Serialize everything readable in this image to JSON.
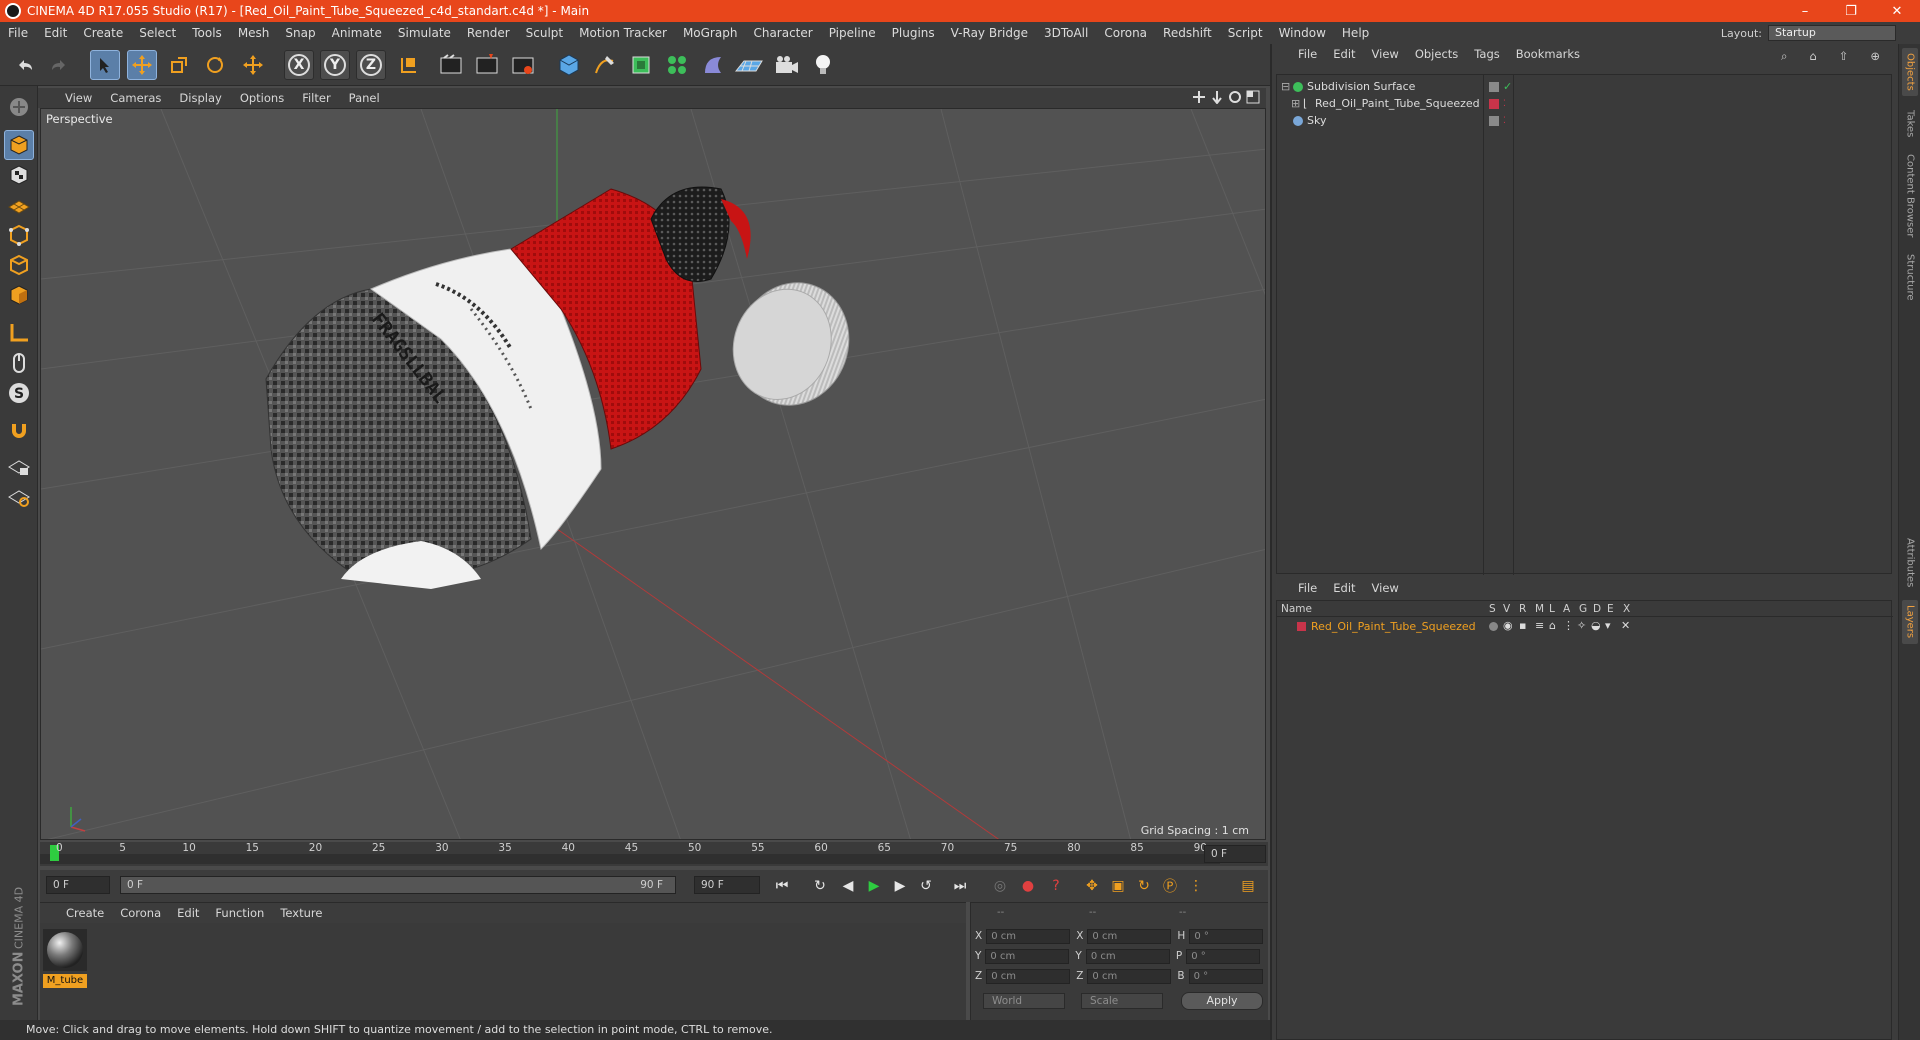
{
  "window": {
    "title": "CINEMA 4D R17.055 Studio (R17) - [Red_Oil_Paint_Tube_Squeezed_c4d_standart.c4d *] - Main",
    "controls": [
      "–",
      "❐",
      "✕"
    ]
  },
  "menubar": {
    "items": [
      "File",
      "Edit",
      "Create",
      "Select",
      "Tools",
      "Mesh",
      "Snap",
      "Animate",
      "Simulate",
      "Render",
      "Sculpt",
      "Motion Tracker",
      "MoGraph",
      "Character",
      "Pipeline",
      "Plugins",
      "V-Ray Bridge",
      "3DToAll",
      "Corona",
      "Redshift",
      "Script",
      "Window",
      "Help"
    ],
    "layout_label": "Layout:",
    "layout_value": "Startup"
  },
  "toolbar": {
    "axis_x": "X",
    "axis_y": "Y",
    "axis_z": "Z"
  },
  "viewport": {
    "menu": [
      "View",
      "Cameras",
      "Display",
      "Options",
      "Filter",
      "Panel"
    ],
    "label": "Perspective",
    "grid_spacing": "Grid Spacing : 1 cm",
    "tube_label": "FRAGSLLBAL"
  },
  "timeline": {
    "ticks": [
      "0",
      "5",
      "10",
      "15",
      "20",
      "25",
      "30",
      "35",
      "40",
      "45",
      "50",
      "55",
      "60",
      "65",
      "70",
      "75",
      "80",
      "85",
      "90"
    ],
    "frame_display": "0 F"
  },
  "transport": {
    "start": "0 F",
    "slider_left": "0 F",
    "slider_right": "90 F",
    "end": "90 F"
  },
  "material_panel": {
    "menu": [
      "Create",
      "Corona",
      "Edit",
      "Function",
      "Texture"
    ],
    "material_name": "M_tube"
  },
  "coordinates": {
    "header": [
      "--",
      "--",
      "--"
    ],
    "rows": [
      {
        "a": "X",
        "av": "0 cm",
        "b": "X",
        "bv": "0 cm",
        "c": "H",
        "cv": "0 °"
      },
      {
        "a": "Y",
        "av": "0 cm",
        "b": "Y",
        "bv": "0 cm",
        "c": "P",
        "cv": "0 °"
      },
      {
        "a": "Z",
        "av": "0 cm",
        "b": "Z",
        "bv": "0 cm",
        "c": "B",
        "cv": "0 °"
      }
    ],
    "mode1": "World",
    "mode2": "Scale",
    "apply": "Apply"
  },
  "status": "Move: Click and drag to move elements. Hold down SHIFT to quantize movement / add to the selection in point mode, CTRL to remove.",
  "objects_panel": {
    "menu": [
      "File",
      "Edit",
      "View",
      "Objects",
      "Tags",
      "Bookmarks"
    ],
    "items": [
      {
        "name": "Subdivision Surface"
      },
      {
        "name": "Red_Oil_Paint_Tube_Squeezed"
      },
      {
        "name": "Sky"
      }
    ]
  },
  "layers_panel": {
    "menu": [
      "File",
      "Edit",
      "View"
    ],
    "columns": [
      "Name",
      "S",
      "V",
      "R",
      "M",
      "L",
      "A",
      "G",
      "D",
      "E",
      "X"
    ],
    "layer_name": "Red_Oil_Paint_Tube_Squeezed"
  },
  "side_tabs": [
    "Objects",
    "Takes",
    "Content Browser",
    "Structure",
    "Attributes",
    "Layers"
  ],
  "brand": {
    "maxon": "MAXON",
    "cinema": "CINEMA 4D"
  },
  "colors": {
    "accent": "#e8461b",
    "selection": "#5b7fa8",
    "layer_red": "#c8344a"
  }
}
